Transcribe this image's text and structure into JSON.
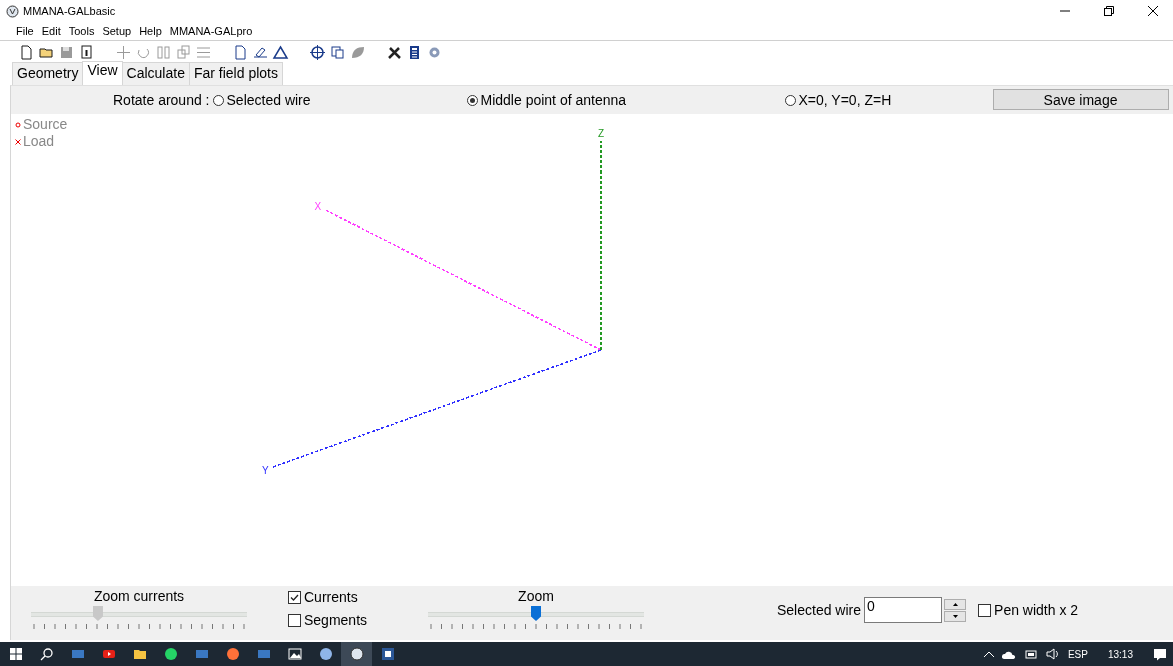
{
  "window": {
    "title": "MMANA-GALbasic"
  },
  "menu": [
    "File",
    "Edit",
    "Tools",
    "Setup",
    "Help",
    "MMANA-GALpro"
  ],
  "tabs": [
    {
      "label": "Geometry",
      "selected": false
    },
    {
      "label": "View",
      "selected": true
    },
    {
      "label": "Calculate",
      "selected": false
    },
    {
      "label": "Far field plots",
      "selected": false
    }
  ],
  "rotate_around": {
    "label": "Rotate around :",
    "options": [
      {
        "label": "Selected wire",
        "selected": false
      },
      {
        "label": "Middle point of antenna",
        "selected": true
      },
      {
        "label": "X=0, Y=0, Z=H",
        "selected": false
      }
    ]
  },
  "save_button": "Save image",
  "legend": [
    {
      "kind": "source",
      "label": "Source"
    },
    {
      "kind": "load",
      "label": "Load"
    }
  ],
  "axes": [
    {
      "label": "X",
      "color": "#ff40ff"
    },
    {
      "label": "Y",
      "color": "#3030ff"
    },
    {
      "label": "Z",
      "color": "#229922"
    }
  ],
  "zoom_currents": {
    "label": "Zoom currents",
    "level": 0.31
  },
  "checkboxes": [
    {
      "label": "Currents",
      "checked": true
    },
    {
      "label": "Segments",
      "checked": false
    }
  ],
  "zoom": {
    "label": "Zoom",
    "level": 0.5
  },
  "selected_wire": {
    "label": "Selected wire",
    "value": "0"
  },
  "pen_width": {
    "label": "Pen width x 2",
    "checked": false
  },
  "taskbar": {
    "language": "ESP",
    "time": "13:13"
  }
}
